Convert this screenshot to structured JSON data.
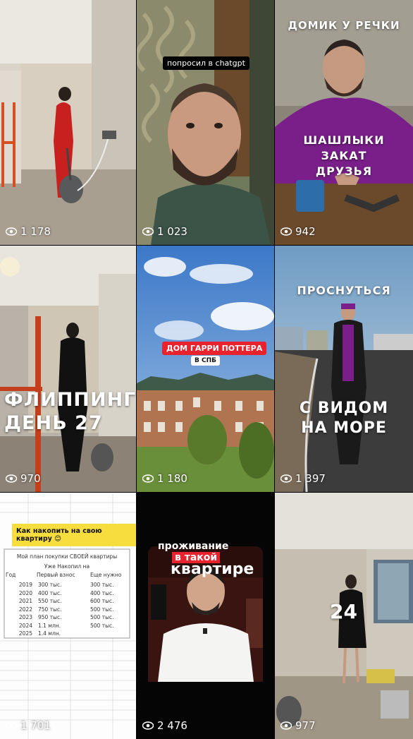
{
  "tiles": [
    {
      "id": "t1",
      "views": "1 178"
    },
    {
      "id": "t2",
      "views": "1 023",
      "caption": "попросил в chatgpt"
    },
    {
      "id": "t3",
      "views": "942",
      "title": "ДОМИК У РЕЧКИ",
      "subtitle": "ШАШЛЫКИ ЗАКАТ ДРУЗЬЯ"
    },
    {
      "id": "t4",
      "views": "970",
      "line1": "ФЛИППИНГ",
      "line2": "ДЕНЬ 27"
    },
    {
      "id": "t5",
      "views": "1 180",
      "tag": "ДОМ ГАРРИ ПОТТЕРА",
      "tag2": "В СПБ"
    },
    {
      "id": "t6",
      "views": "1 397",
      "top": "ПРОСНУТЬСЯ",
      "line1": "С ВИДОМ",
      "line2": "НА МОРЕ"
    },
    {
      "id": "t7",
      "views": "1 701",
      "banner": "Как накопить на свою квартиру 😊",
      "sheet_title": "Мой план покупки СВОЕЙ квартиры",
      "sheet_subtitle": "Уже Накопил на",
      "headers": [
        "Год",
        "Первый взнос",
        "Еще нужно"
      ],
      "rows": [
        [
          "2019",
          "300 тыс.",
          "300 тыс."
        ],
        [
          "2020",
          "400 тыс.",
          "400 тыс."
        ],
        [
          "2021",
          "550 тыс.",
          "600 тыс."
        ],
        [
          "2022",
          "750 тыс.",
          "500 тыс."
        ],
        [
          "2023",
          "950 тыс.",
          "500 тыс."
        ],
        [
          "2024",
          "1.1 млн.",
          "500 тыс."
        ],
        [
          "2025",
          "1.4 млн.",
          ""
        ]
      ]
    },
    {
      "id": "t8",
      "views": "2 476",
      "line1": "проживание",
      "line2": "в такой",
      "line3": "квартире"
    },
    {
      "id": "t9",
      "views": "977",
      "number": "24"
    }
  ]
}
